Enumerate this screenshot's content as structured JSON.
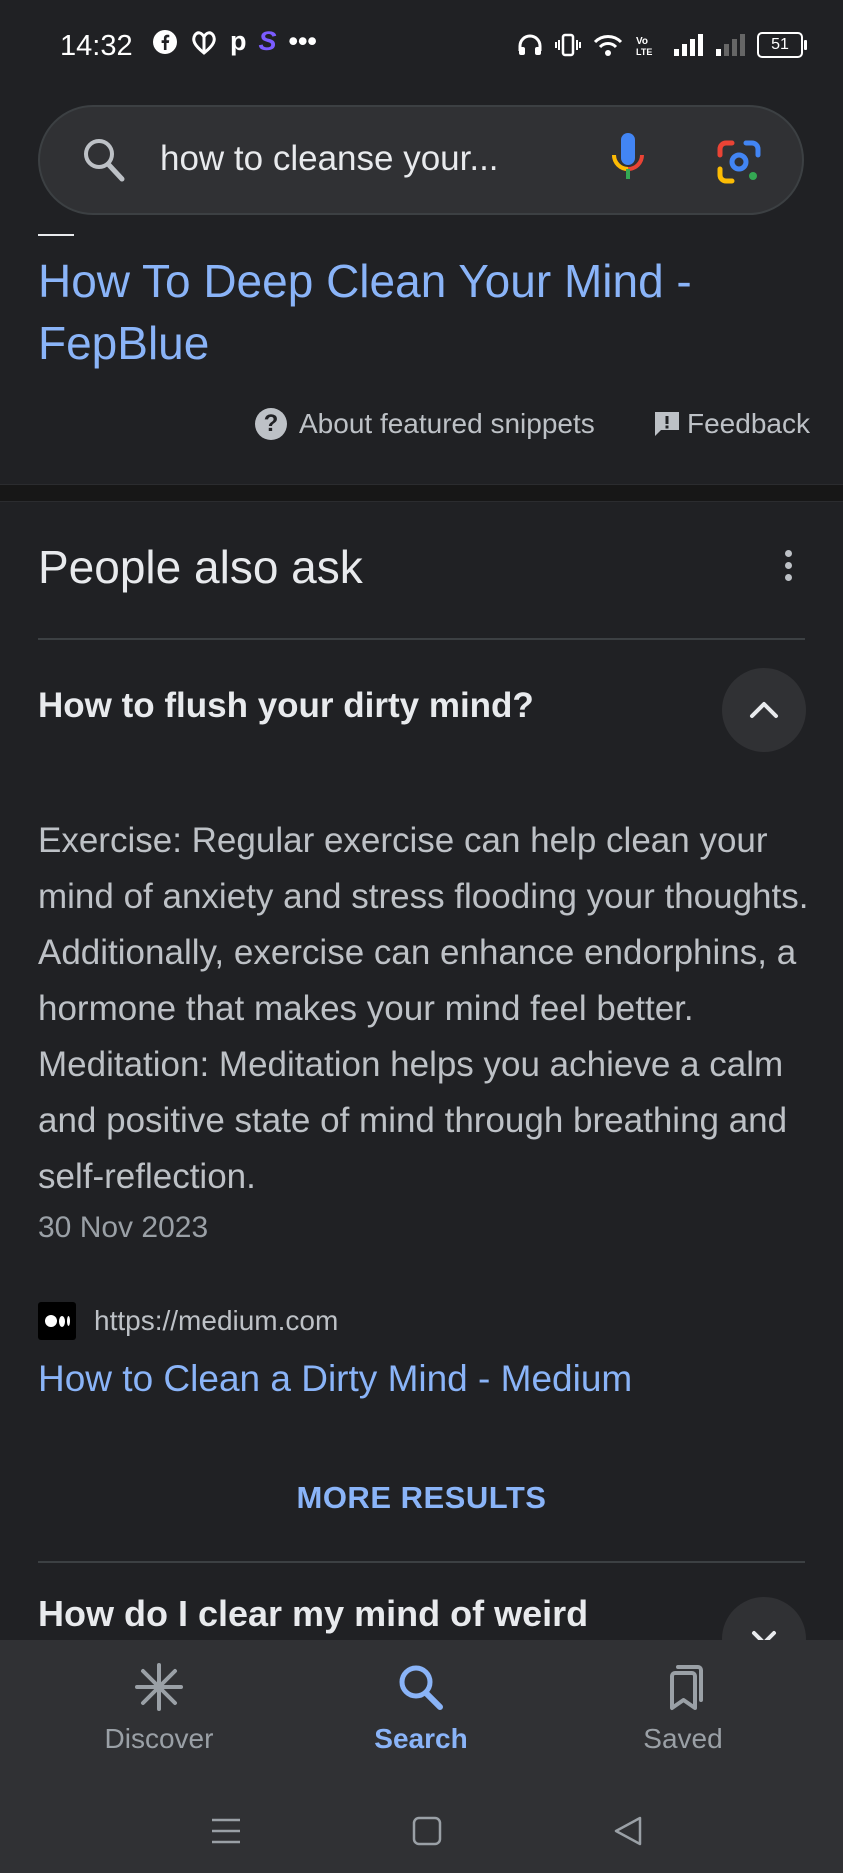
{
  "status_bar": {
    "time": "14:32",
    "battery": "51",
    "left_icons": [
      "facebook-icon",
      "heart-hands-icon",
      "p-app-icon",
      "s-app-icon",
      "more-dots-icon"
    ],
    "right_icons": [
      "headphones-icon",
      "vibrate-icon",
      "wifi-icon",
      "volte-icon",
      "signal-icon",
      "signal-weak-icon",
      "battery-icon"
    ]
  },
  "search": {
    "query": "how to cleanse your..."
  },
  "featured_snippet": {
    "title": "How To Deep Clean Your Mind - FepBlue",
    "about_label": "About featured snippets",
    "feedback_label": "Feedback"
  },
  "people_also_ask": {
    "title": "People also ask",
    "items": [
      {
        "question": "How to flush your dirty mind?",
        "answer": "Exercise: Regular exercise can help clean your mind of anxiety and stress flooding your thoughts. Additionally, exercise can enhance endorphins, a hormone that makes your mind feel better. Meditation: Meditation helps you achieve a calm and positive state of mind through breathing and self-reflection.",
        "date": "30 Nov 2023",
        "source_url": "https://medium.com",
        "source_title": "How to Clean a Dirty Mind - Medium",
        "more_label": "MORE RESULTS"
      },
      {
        "question": "How do I clear my mind of weird"
      }
    ]
  },
  "bottom_nav": {
    "items": [
      {
        "label": "Discover",
        "icon": "asterisk-icon"
      },
      {
        "label": "Search",
        "icon": "search-icon",
        "active": true
      },
      {
        "label": "Saved",
        "icon": "bookmarks-icon"
      }
    ]
  },
  "colors": {
    "background": "#202124",
    "link": "#8ab4f8",
    "text": "#e8eaed",
    "secondary_text": "#bdc1c6",
    "nav_bg": "#303134"
  }
}
